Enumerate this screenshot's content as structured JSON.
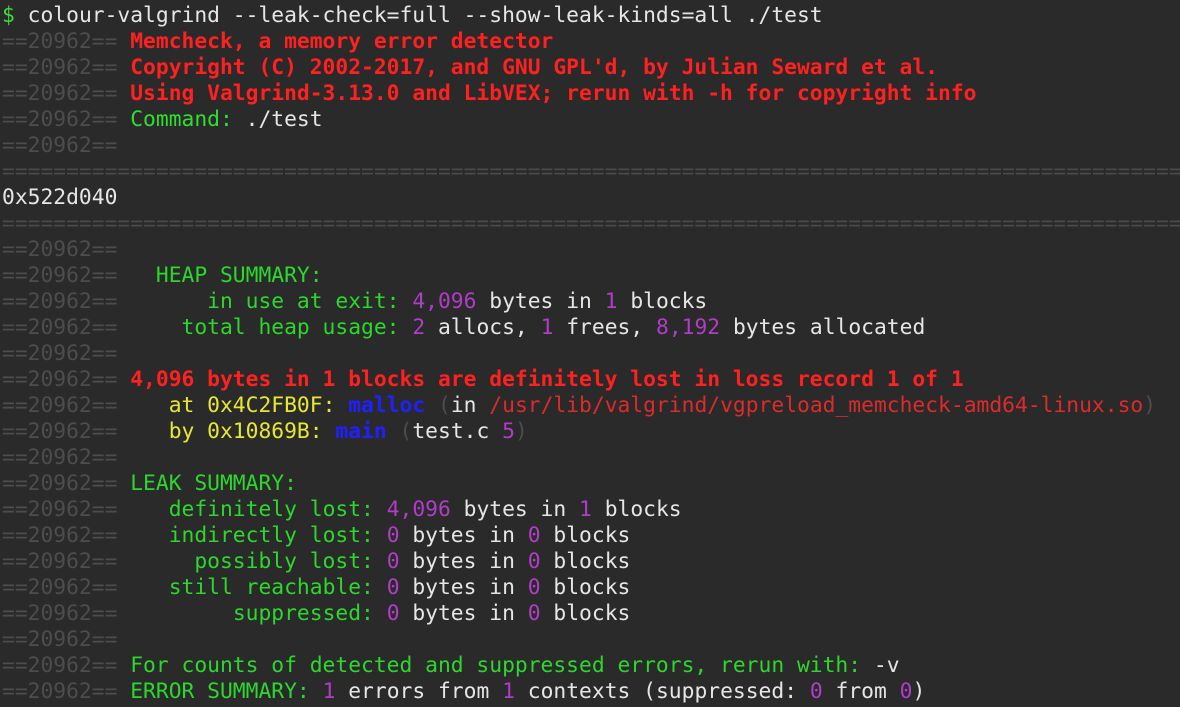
{
  "command_line": {
    "prompt": "$",
    "command": "colour-valgrind --leak-check=full --show-leak-kinds=all ./test"
  },
  "pid_prefix": "==20962==",
  "header": {
    "title": "Memcheck, a memory error detector",
    "copyright": "Copyright (C) 2002-2017, and GNU GPL'd, by Julian Seward et al.",
    "version": "Using Valgrind-3.13.0 and LibVEX; rerun with -h for copyright info",
    "command_label": "Command:",
    "command_value": "./test"
  },
  "separator": "================================================================================================================================================",
  "program_output": "0x522d040",
  "heap_summary": {
    "label": "HEAP SUMMARY:",
    "in_use_label": "in use at exit:",
    "in_use_bytes": "4,096",
    "in_use_bytes_word": "bytes in",
    "in_use_blocks": "1",
    "in_use_blocks_word": "blocks",
    "total_label": "total heap usage:",
    "allocs": "2",
    "allocs_word": "allocs,",
    "frees": "1",
    "frees_word": "frees,",
    "allocated": "8,192",
    "allocated_word": "bytes allocated"
  },
  "loss_record": {
    "message": "4,096 bytes in 1 blocks are definitely lost in loss record 1 of 1",
    "frame1_prefix": "at 0x4C2FB0F:",
    "frame1_func": "malloc",
    "frame1_open": "(",
    "frame1_in": "in",
    "frame1_path": "/usr/lib/valgrind/vgpreload_memcheck-amd64-linux.so",
    "frame1_close": ")",
    "frame2_prefix": "by 0x10869B:",
    "frame2_func": "main",
    "frame2_open": "(",
    "frame2_file": "test.c",
    "frame2_line": "5",
    "frame2_close": ")"
  },
  "leak_summary": {
    "label": "LEAK SUMMARY:",
    "rows": [
      {
        "label": "definitely lost:",
        "bytes": "4,096",
        "bytes_word": "bytes in",
        "blocks": "1",
        "blocks_word": "blocks"
      },
      {
        "label": "indirectly lost:",
        "bytes": "0",
        "bytes_word": "bytes in",
        "blocks": "0",
        "blocks_word": "blocks"
      },
      {
        "label": "possibly lost:",
        "bytes": "0",
        "bytes_word": "bytes in",
        "blocks": "0",
        "blocks_word": "blocks"
      },
      {
        "label": "still reachable:",
        "bytes": "0",
        "bytes_word": "bytes in",
        "blocks": "0",
        "blocks_word": "blocks"
      },
      {
        "label": "suppressed:",
        "bytes": "0",
        "bytes_word": "bytes in",
        "blocks": "0",
        "blocks_word": "blocks"
      }
    ]
  },
  "footer": {
    "counts_hint": "For counts of detected and suppressed errors, rerun with:",
    "counts_flag": "-v",
    "error_label": "ERROR SUMMARY:",
    "errors": "1",
    "errors_word": "errors from",
    "contexts": "1",
    "contexts_word": "contexts (suppressed:",
    "suppressed": "0",
    "from_word": "from",
    "from_count": "0",
    "close_paren": ")"
  },
  "colors": {
    "background": "#2a2a2a",
    "pid": "#4d4d4d",
    "error_red": "#ff2020",
    "green": "#2ee02e",
    "number_purple": "#b13cc8",
    "function_blue": "#2020ff",
    "address_yellow": "#e8e830"
  }
}
